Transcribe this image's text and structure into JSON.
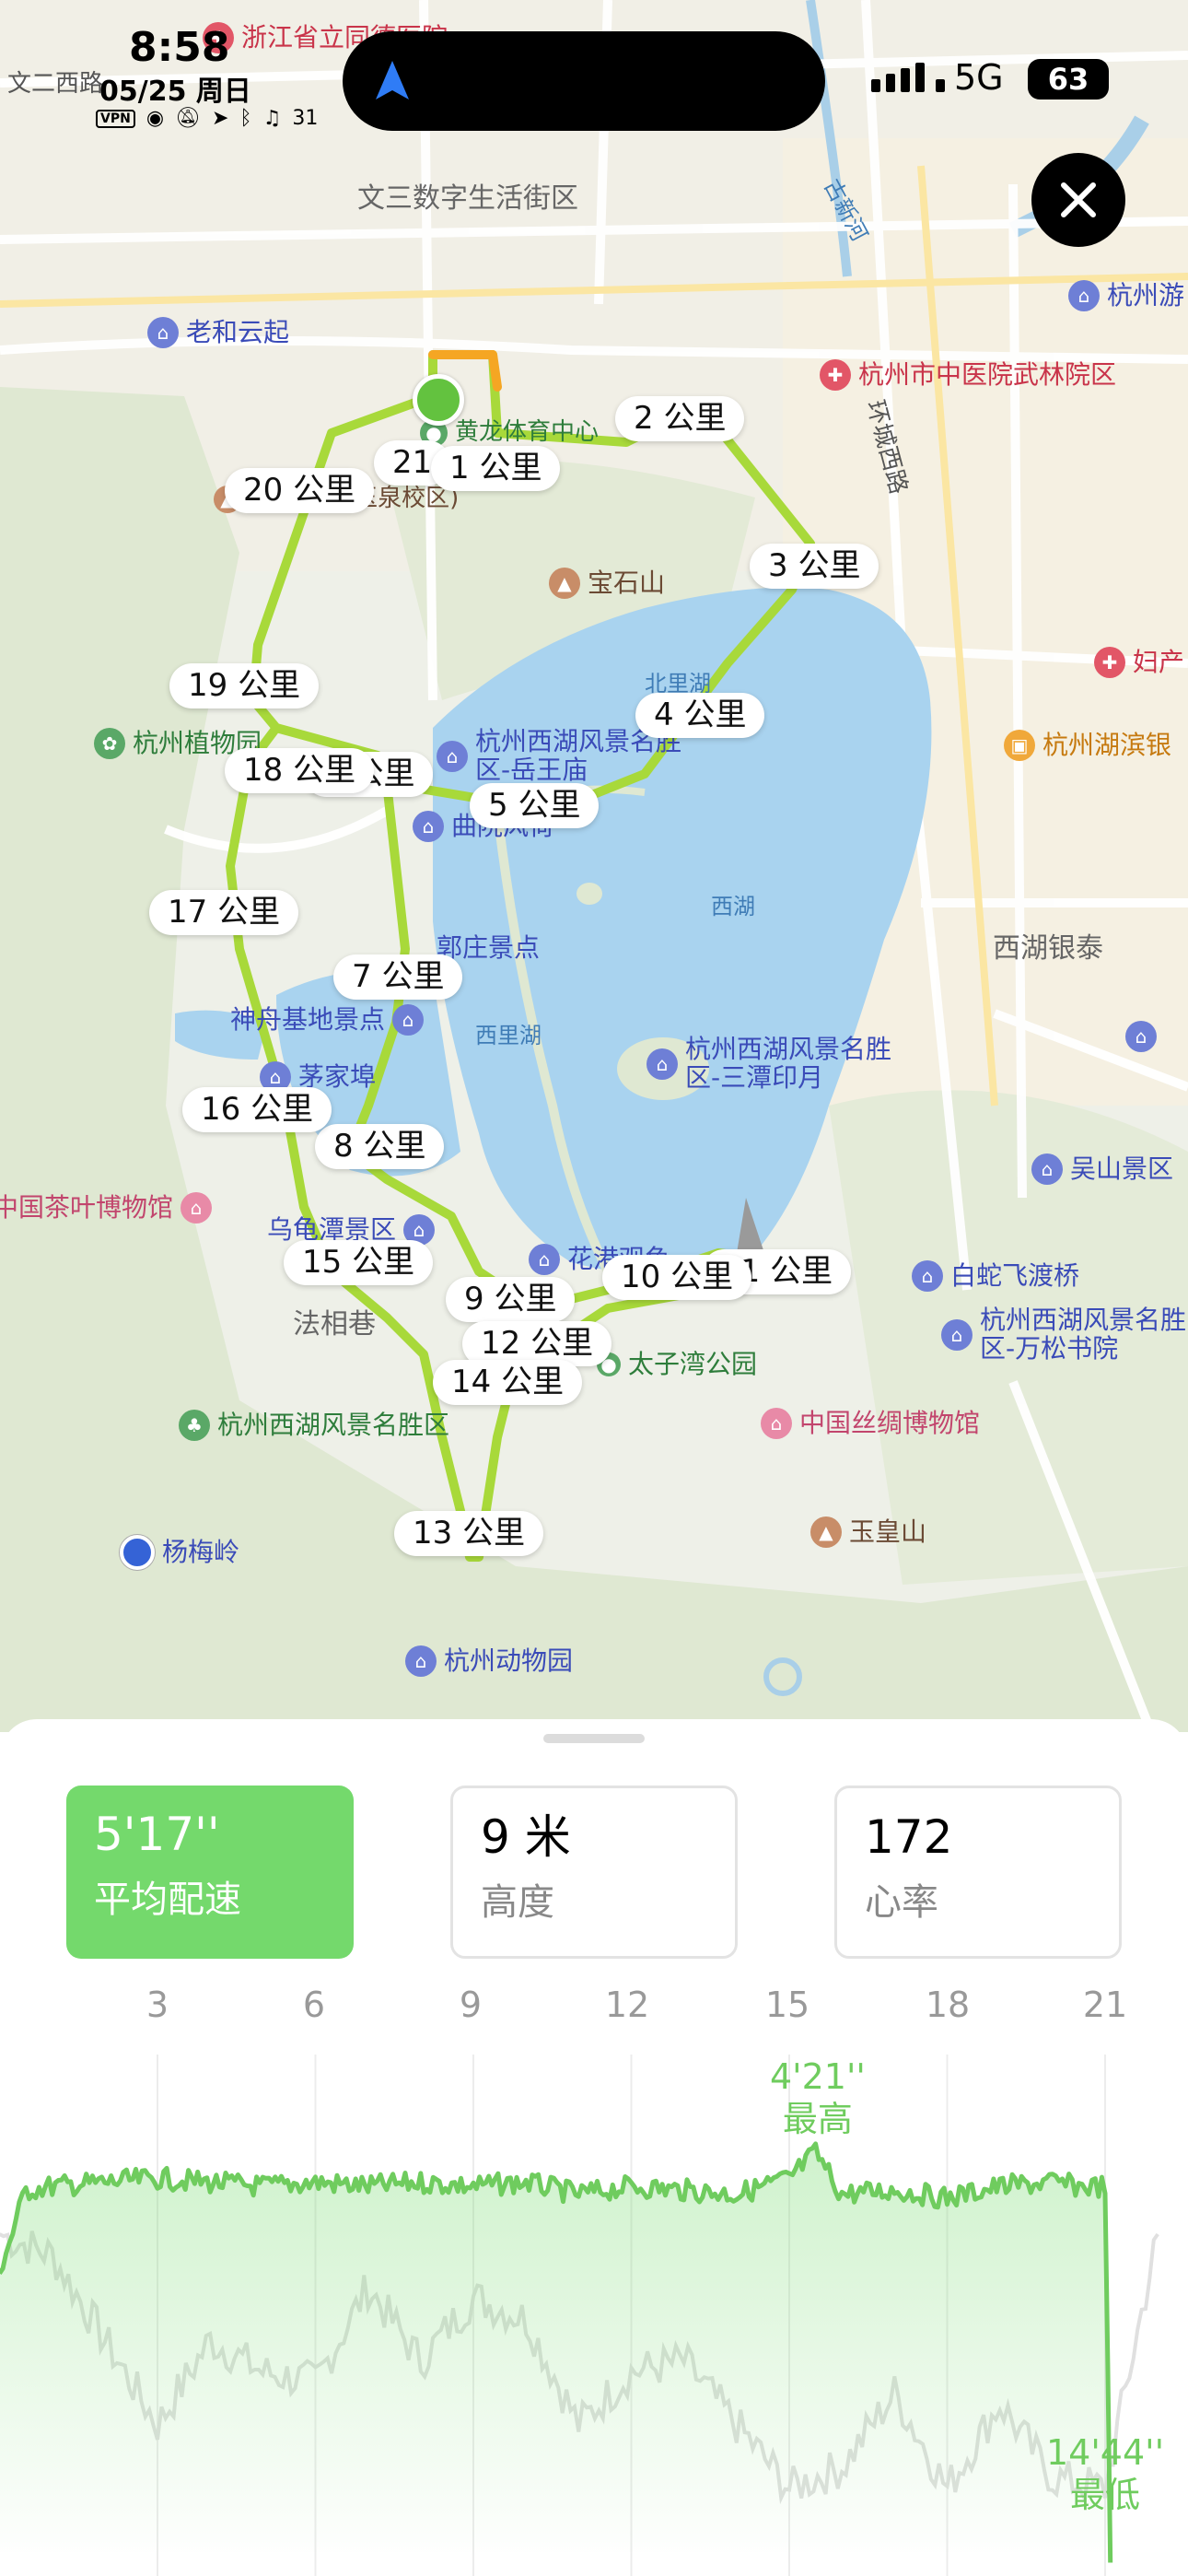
{
  "status_bar": {
    "time": "8:58",
    "date": "05/25 周日",
    "vpn": "VPN",
    "notification_count": "31",
    "network": "5G",
    "battery": "63"
  },
  "map": {
    "places": [
      {
        "name": "浙江省立同德医院",
        "color": "red"
      },
      {
        "name": "文二西路",
        "color": "gray"
      },
      {
        "name": "文三数字生活街区",
        "color": "district"
      },
      {
        "name": "古新河",
        "color": "water"
      },
      {
        "name": "杭州游",
        "color": "blue"
      },
      {
        "name": "老和云起",
        "color": "blue"
      },
      {
        "name": "杭州市中医院武林院区",
        "color": "red"
      },
      {
        "name": "黄龙体育中心",
        "color": "green"
      },
      {
        "name": "环城西路",
        "color": "gray"
      },
      {
        "name": "浙江大学(玉泉校区)",
        "color": "brown"
      },
      {
        "name": "宝石山",
        "color": "brown"
      },
      {
        "name": "北里湖",
        "color": "water"
      },
      {
        "name": "妇产",
        "color": "red"
      },
      {
        "name": "杭州植物园",
        "color": "green"
      },
      {
        "name": "杭州西湖风景名胜区-岳王庙",
        "color": "blue"
      },
      {
        "name": "杭州湖滨银",
        "color": "orange"
      },
      {
        "name": "曲院风荷",
        "color": "blue"
      },
      {
        "name": "西湖",
        "color": "water"
      },
      {
        "name": "郭庄景点",
        "color": "blue"
      },
      {
        "name": "西湖银泰",
        "color": "district"
      },
      {
        "name": "神舟基地景点",
        "color": "blue"
      },
      {
        "name": "西里湖",
        "color": "water"
      },
      {
        "name": "杭州西湖风景名胜区-三潭印月",
        "color": "blue"
      },
      {
        "name": "茅家埠",
        "color": "blue"
      },
      {
        "name": "吴山景区",
        "color": "blue"
      },
      {
        "name": "中国茶叶博物馆",
        "color": "pink"
      },
      {
        "name": "乌龟潭景区",
        "color": "blue"
      },
      {
        "name": "花港观鱼",
        "color": "blue"
      },
      {
        "name": "白蛇飞渡桥",
        "color": "blue"
      },
      {
        "name": "法相巷",
        "color": "district"
      },
      {
        "name": "杭州西湖风景名胜区-万松书院",
        "color": "blue"
      },
      {
        "name": "太子湾公园",
        "color": "green"
      },
      {
        "name": "杭州西湖风景名胜区",
        "color": "green"
      },
      {
        "name": "中国丝绸博物馆",
        "color": "pink"
      },
      {
        "name": "杨梅岭",
        "color": "dot"
      },
      {
        "name": "玉皇山",
        "color": "brown"
      },
      {
        "name": "杭州动物园",
        "color": "blue"
      }
    ],
    "km_markers": [
      "21",
      "1 公里",
      "2 公里",
      "3 公里",
      "4 公里",
      "5 公里",
      "6 公里",
      "7 公里",
      "8 公里",
      "9 公里",
      "10 公里",
      "11 公里",
      "12 公里",
      "13 公里",
      "14 公里",
      "15 公里",
      "16 公里",
      "17 公里",
      "18 公里",
      "19 公里",
      "20 公里"
    ],
    "route_color": "#a8d93a"
  },
  "metrics": [
    {
      "value": "5'17''",
      "label": "平均配速",
      "active": true
    },
    {
      "value": "9 米",
      "label": "高度",
      "active": false
    },
    {
      "value": "172",
      "label": "心率",
      "active": false
    }
  ],
  "chart_data": {
    "type": "line",
    "x_ticks": [
      "3",
      "6",
      "9",
      "12",
      "15",
      "18",
      "21"
    ],
    "x_unit": "公里",
    "series": [
      {
        "name": "平均配速",
        "color": "#6fcc5e",
        "x": [
          0,
          0.5,
          1,
          2,
          3,
          4,
          5,
          6,
          7,
          8,
          9,
          10,
          11,
          12,
          13,
          14,
          15,
          15.5,
          16,
          17,
          18,
          19,
          20,
          20.5,
          21,
          21.1
        ],
        "values": [
          7.4,
          5.3,
          5.2,
          5.1,
          5.0,
          5.1,
          5.2,
          5.1,
          5.2,
          5.1,
          5.2,
          5.1,
          5.4,
          5.2,
          5.3,
          5.4,
          5.0,
          4.35,
          5.4,
          5.3,
          5.5,
          5.2,
          5.1,
          5.2,
          5.2,
          14.7
        ]
      },
      {
        "name": "高度",
        "color": "#e0e0e0",
        "x": [
          0,
          1,
          2,
          3,
          4,
          5,
          6,
          7,
          8,
          9,
          10,
          11,
          12,
          13,
          14,
          15,
          16,
          17,
          18,
          19,
          20,
          21,
          22
        ],
        "values": [
          30,
          28,
          20,
          12,
          20,
          17,
          16,
          25,
          18,
          24,
          22,
          12,
          17,
          18,
          12,
          6,
          8,
          15,
          6,
          14,
          7,
          6,
          30
        ]
      }
    ],
    "annotations": [
      {
        "value": "4'21''",
        "label": "最高"
      },
      {
        "value": "14'44''",
        "label": "最低"
      }
    ]
  }
}
